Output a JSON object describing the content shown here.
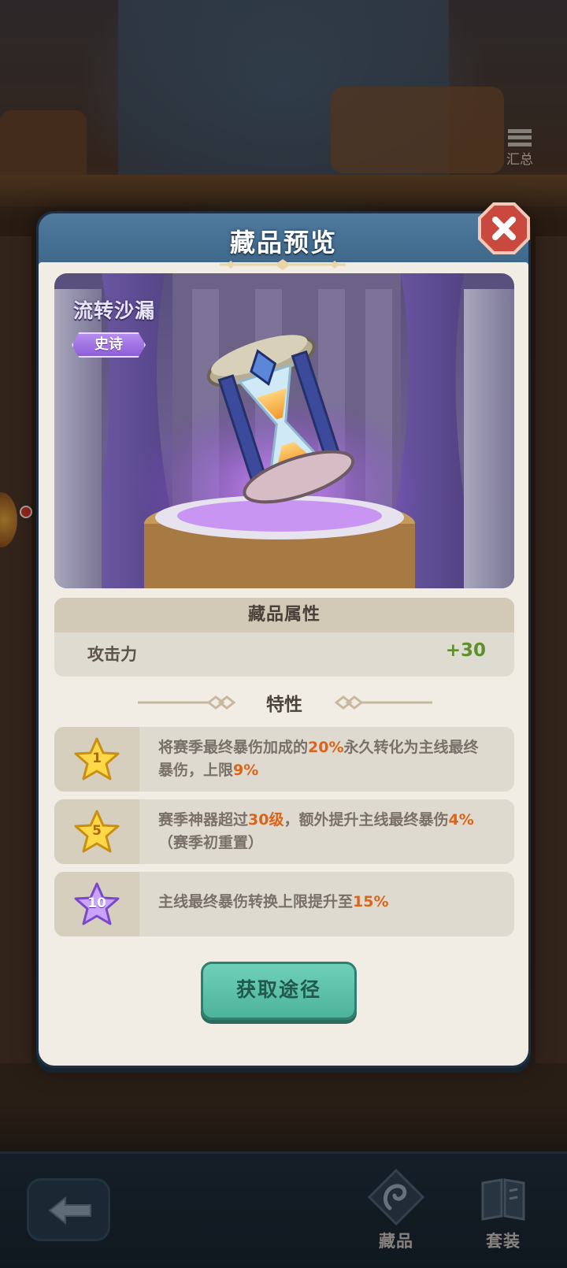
{
  "modal": {
    "title": "藏品预览",
    "item_name": "流转沙漏",
    "rarity": "史诗"
  },
  "attributes": {
    "header": "藏品属性",
    "rows": [
      {
        "name": "攻击力",
        "value": "+30"
      }
    ]
  },
  "traits": {
    "title": "特性",
    "items": [
      {
        "level": "1",
        "star_color": "gold",
        "text_parts": [
          "将赛季最终暴伤加成的",
          "20%",
          "永久转化为主线最终暴伤，上限",
          "9%"
        ]
      },
      {
        "level": "5",
        "star_color": "gold",
        "text_parts": [
          "赛季神器超过",
          "30级",
          "，额外提升主线最终暴伤",
          "4%",
          "（赛季初重置）"
        ]
      },
      {
        "level": "10",
        "star_color": "purple",
        "text_parts": [
          "主线最终暴伤转换上限提升至",
          "15%"
        ]
      }
    ]
  },
  "actions": {
    "obtain_label": "获取途径"
  },
  "topbar": {
    "summary_label": "汇总"
  },
  "bottom_nav": {
    "collection_label": "藏品",
    "sets_label": "套装"
  },
  "colors": {
    "highlight": "#d9641a",
    "attribute_value": "#5d8f2c",
    "button": "#4db39b",
    "epic": "#8c5ed8"
  },
  "icons": [
    "summary-icon",
    "close-icon",
    "hourglass-icon",
    "star-icon",
    "back-arrow-icon",
    "collection-icon",
    "sets-book-icon"
  ]
}
